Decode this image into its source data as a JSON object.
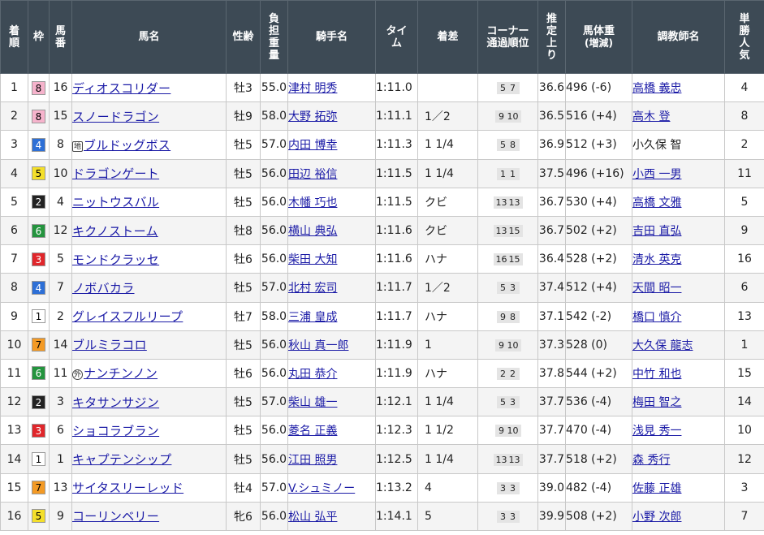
{
  "colors": {
    "header_bg": "#3d4a55",
    "link": "#1a1aa6",
    "waku": {
      "1": {
        "bg": "#ffffff",
        "fg": "#000000"
      },
      "2": {
        "bg": "#222222",
        "fg": "#ffffff"
      },
      "3": {
        "bg": "#e0262b",
        "fg": "#ffffff"
      },
      "4": {
        "bg": "#2d6fd6",
        "fg": "#ffffff"
      },
      "5": {
        "bg": "#f4df2a",
        "fg": "#000000"
      },
      "6": {
        "bg": "#24943e",
        "fg": "#ffffff"
      },
      "7": {
        "bg": "#f39a25",
        "fg": "#000000"
      },
      "8": {
        "bg": "#f6b3cc",
        "fg": "#000000"
      }
    }
  },
  "headers": {
    "rank": "着順",
    "waku": "枠",
    "umaban": "馬番",
    "horse": "馬名",
    "sexage": "性齢",
    "weight": "負担重量",
    "jockey": "騎手名",
    "time": "タイム",
    "margin": "着差",
    "corner": "コーナー通過順位",
    "last3f": "推定上り",
    "bodyweight_main": "馬体重",
    "bodyweight_sub": "(増減)",
    "trainer": "調教師名",
    "popularity": "単勝人気"
  },
  "rows": [
    {
      "rank": "1",
      "waku": "8",
      "umaban": "16",
      "mark": "",
      "horse": "ディオスコリダー",
      "sexage": "牡3",
      "weight": "55.0",
      "jockey": "津村 明秀",
      "time": "1:11.0",
      "margin": "",
      "corner": [
        "5",
        "7"
      ],
      "last3f": "36.6",
      "bodyweight": "496 (-6)",
      "trainer": "高橋 義忠",
      "trainer_link": true,
      "popularity": "4"
    },
    {
      "rank": "2",
      "waku": "8",
      "umaban": "15",
      "mark": "",
      "horse": "スノードラゴン",
      "sexage": "牡9",
      "weight": "58.0",
      "jockey": "大野 拓弥",
      "time": "1:11.1",
      "margin": "1／2",
      "corner": [
        "9",
        "10"
      ],
      "last3f": "36.5",
      "bodyweight": "516 (+4)",
      "trainer": "高木 登",
      "trainer_link": true,
      "popularity": "8"
    },
    {
      "rank": "3",
      "waku": "4",
      "umaban": "8",
      "mark": "地",
      "horse": "ブルドッグボス",
      "sexage": "牡5",
      "weight": "57.0",
      "jockey": "内田 博幸",
      "time": "1:11.3",
      "margin": "1 1/4",
      "corner": [
        "5",
        "8"
      ],
      "last3f": "36.9",
      "bodyweight": "512 (+3)",
      "trainer": "小久保 智",
      "trainer_link": false,
      "popularity": "2"
    },
    {
      "rank": "4",
      "waku": "5",
      "umaban": "10",
      "mark": "",
      "horse": "ドラゴンゲート",
      "sexage": "牡5",
      "weight": "56.0",
      "jockey": "田辺 裕信",
      "time": "1:11.5",
      "margin": "1 1/4",
      "corner": [
        "1",
        "1"
      ],
      "last3f": "37.5",
      "bodyweight": "496 (+16)",
      "trainer": "小西 一男",
      "trainer_link": true,
      "popularity": "11"
    },
    {
      "rank": "5",
      "waku": "2",
      "umaban": "4",
      "mark": "",
      "horse": "ニットウスバル",
      "sexage": "牡5",
      "weight": "56.0",
      "jockey": "木幡 巧也",
      "time": "1:11.5",
      "margin": "クビ",
      "corner": [
        "13",
        "13"
      ],
      "last3f": "36.7",
      "bodyweight": "530 (+4)",
      "trainer": "高橋 文雅",
      "trainer_link": true,
      "popularity": "5"
    },
    {
      "rank": "6",
      "waku": "6",
      "umaban": "12",
      "mark": "",
      "horse": "キクノストーム",
      "sexage": "牡8",
      "weight": "56.0",
      "jockey": "横山 典弘",
      "time": "1:11.6",
      "margin": "クビ",
      "corner": [
        "13",
        "15"
      ],
      "last3f": "36.7",
      "bodyweight": "502 (+2)",
      "trainer": "吉田 直弘",
      "trainer_link": true,
      "popularity": "9"
    },
    {
      "rank": "7",
      "waku": "3",
      "umaban": "5",
      "mark": "",
      "horse": "モンドクラッセ",
      "sexage": "牡6",
      "weight": "56.0",
      "jockey": "柴田 大知",
      "time": "1:11.6",
      "margin": "ハナ",
      "corner": [
        "16",
        "15"
      ],
      "last3f": "36.4",
      "bodyweight": "528 (+2)",
      "trainer": "清水 英克",
      "trainer_link": true,
      "popularity": "16"
    },
    {
      "rank": "8",
      "waku": "4",
      "umaban": "7",
      "mark": "",
      "horse": "ノボバカラ",
      "sexage": "牡5",
      "weight": "57.0",
      "jockey": "北村 宏司",
      "time": "1:11.7",
      "margin": "1／2",
      "corner": [
        "5",
        "3"
      ],
      "last3f": "37.4",
      "bodyweight": "512 (+4)",
      "trainer": "天間 昭一",
      "trainer_link": true,
      "popularity": "6"
    },
    {
      "rank": "9",
      "waku": "1",
      "umaban": "2",
      "mark": "",
      "horse": "グレイスフルリープ",
      "sexage": "牡7",
      "weight": "58.0",
      "jockey": "三浦 皇成",
      "time": "1:11.7",
      "margin": "ハナ",
      "corner": [
        "9",
        "8"
      ],
      "last3f": "37.1",
      "bodyweight": "542 (-2)",
      "trainer": "橋口 慎介",
      "trainer_link": true,
      "popularity": "13"
    },
    {
      "rank": "10",
      "waku": "7",
      "umaban": "14",
      "mark": "",
      "horse": "ブルミラコロ",
      "sexage": "牡5",
      "weight": "56.0",
      "jockey": "秋山 真一郎",
      "time": "1:11.9",
      "margin": "1",
      "corner": [
        "9",
        "10"
      ],
      "last3f": "37.3",
      "bodyweight": "528 (0)",
      "trainer": "大久保 龍志",
      "trainer_link": true,
      "popularity": "1"
    },
    {
      "rank": "11",
      "waku": "6",
      "umaban": "11",
      "mark": "外",
      "horse": "ナンチンノン",
      "sexage": "牡6",
      "weight": "56.0",
      "jockey": "丸田 恭介",
      "time": "1:11.9",
      "margin": "ハナ",
      "corner": [
        "2",
        "2"
      ],
      "last3f": "37.8",
      "bodyweight": "544 (+2)",
      "trainer": "中竹 和也",
      "trainer_link": true,
      "popularity": "15"
    },
    {
      "rank": "12",
      "waku": "2",
      "umaban": "3",
      "mark": "",
      "horse": "キタサンサジン",
      "sexage": "牡5",
      "weight": "57.0",
      "jockey": "柴山 雄一",
      "time": "1:12.1",
      "margin": "1 1/4",
      "corner": [
        "5",
        "3"
      ],
      "last3f": "37.7",
      "bodyweight": "536 (-4)",
      "trainer": "梅田 智之",
      "trainer_link": true,
      "popularity": "14"
    },
    {
      "rank": "13",
      "waku": "3",
      "umaban": "6",
      "mark": "",
      "horse": "ショコラブラン",
      "sexage": "牡5",
      "weight": "56.0",
      "jockey": "菱名 正義",
      "time": "1:12.3",
      "margin": "1 1/2",
      "corner": [
        "9",
        "10"
      ],
      "last3f": "37.7",
      "bodyweight": "470 (-4)",
      "trainer": "浅見 秀一",
      "trainer_link": true,
      "popularity": "10"
    },
    {
      "rank": "14",
      "waku": "1",
      "umaban": "1",
      "mark": "",
      "horse": "キャプテンシップ",
      "sexage": "牡5",
      "weight": "56.0",
      "jockey": "江田 照男",
      "time": "1:12.5",
      "margin": "1 1/4",
      "corner": [
        "13",
        "13"
      ],
      "last3f": "37.7",
      "bodyweight": "518 (+2)",
      "trainer": "森 秀行",
      "trainer_link": true,
      "popularity": "12"
    },
    {
      "rank": "15",
      "waku": "7",
      "umaban": "13",
      "mark": "",
      "horse": "サイタスリーレッド",
      "sexage": "牡4",
      "weight": "57.0",
      "jockey": "V.シュミノー",
      "time": "1:13.2",
      "margin": "4",
      "corner": [
        "3",
        "3"
      ],
      "last3f": "39.0",
      "bodyweight": "482 (-4)",
      "trainer": "佐藤 正雄",
      "trainer_link": true,
      "popularity": "3"
    },
    {
      "rank": "16",
      "waku": "5",
      "umaban": "9",
      "mark": "",
      "horse": "コーリンベリー",
      "sexage": "牝6",
      "weight": "56.0",
      "jockey": "松山 弘平",
      "time": "1:14.1",
      "margin": "5",
      "corner": [
        "3",
        "3"
      ],
      "last3f": "39.9",
      "bodyweight": "508 (+2)",
      "trainer": "小野 次郎",
      "trainer_link": true,
      "popularity": "7"
    }
  ]
}
